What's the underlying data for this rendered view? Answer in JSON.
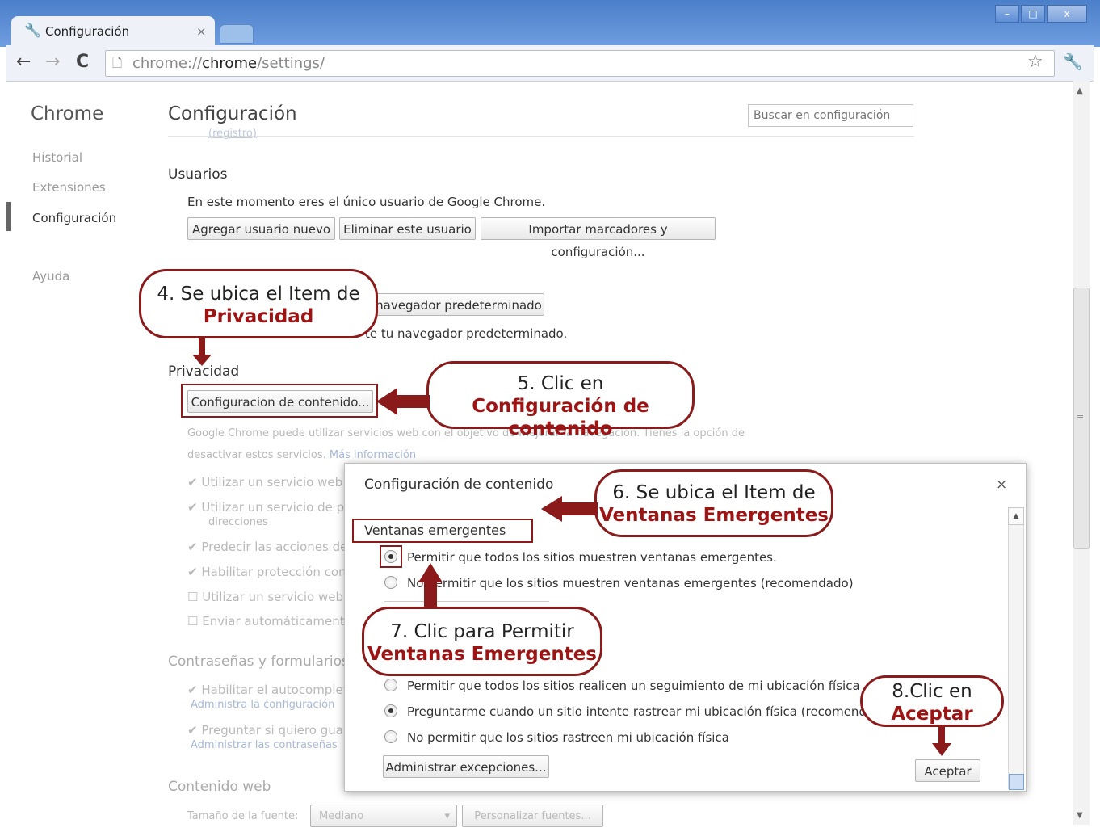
{
  "browser": {
    "tab_title": "Configuración",
    "tab_close": "×",
    "url_scheme": "chrome://",
    "url_host": "chrome",
    "url_path": "/settings/",
    "win_min": "–",
    "win_max": "□",
    "win_close": "x"
  },
  "sidebar": {
    "title": "Chrome",
    "items": [
      "Historial",
      "Extensiones",
      "Configuración",
      "Ayuda"
    ]
  },
  "main": {
    "title": "Configuración",
    "search_placeholder": "Buscar en configuración",
    "faded_link": "(registro)",
    "users_heading": "Usuarios",
    "users_text": "En este momento eres el único usuario de Google Chrome.",
    "users_buttons": [
      "Agregar usuario nuevo",
      "Eliminar este usuario",
      "Importar marcadores y configuración..."
    ],
    "default_browser_button": "navegador predeterminado",
    "default_browser_text": "te tu navegador predeterminado.",
    "privacy_heading": "Privacidad",
    "content_settings_button": "Configuracion de contenido...",
    "privacy_text_1": "Google Chrome puede utilizar servicios web con el objetivo de mejorar la navegación. Tienes la opción de",
    "privacy_text_2": "desactivar estos servicios.",
    "privacy_more_link": "Más información",
    "privacy_checks": [
      "Utilizar un servicio web p",
      "Utilizar un servicio de pr",
      "Predecir las acciones de",
      "Habilitar protección con",
      "Utilizar un servicio web p",
      "Enviar automáticamente"
    ],
    "privacy_check_extra": "direcciones",
    "passwords_heading": "Contraseñas y formularios",
    "passwords_checks": [
      "Habilitar el autocomplet",
      "Preguntar si quiero guar"
    ],
    "passwords_links": [
      "Administra la configuración",
      "Administrar las contraseñas"
    ],
    "web_content_heading": "Contenido web",
    "font_size_label": "Tamaño de la fuente:",
    "font_size_value": "Mediano",
    "customize_fonts_button": "Personalizar fuentes..."
  },
  "dialog": {
    "title": "Configuración de contenido",
    "close": "×",
    "popups_heading": "Ventanas emergentes",
    "popup_allow": "Permitir que todos los sitios muestren ventanas emergentes.",
    "popup_block": "No permitir que los sitios muestren ventanas emergentes (recomendado)",
    "location_allow": "Permitir que todos los sitios realicen un seguimiento de mi ubicación física",
    "location_ask": "Preguntarme cuando un sitio intente rastrear mi ubicación física (recomendado)",
    "location_block": "No permitir que los sitios rastreen mi ubicación física",
    "exceptions_button": "Administrar excepciones...",
    "accept_button": "Aceptar"
  },
  "callouts": {
    "c4_line1": "4. Se ubica el Item de",
    "c4_line2": "Privacidad",
    "c5_line1": "5. Clic en",
    "c5_line2": "Configuración de contenido",
    "c6_line1": "6. Se ubica el Item de",
    "c6_line2": "Ventanas Emergentes",
    "c7_line1": "7. Clic para Permitir",
    "c7_line2": "Ventanas Emergentes",
    "c8_line1": "8.Clic en",
    "c8_line2": "Aceptar"
  },
  "colors": {
    "callout_border": "#8b1a1a",
    "callout_strong": "#9c1414",
    "title_bar": "#4b7fc9"
  }
}
